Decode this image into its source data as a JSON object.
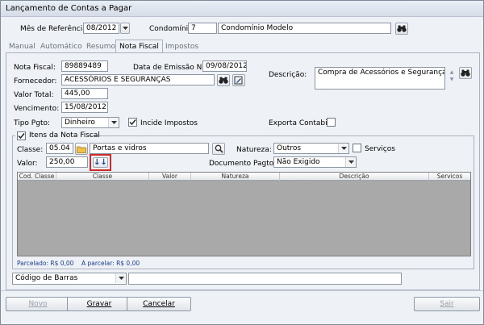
{
  "window": {
    "title": "Lançamento de Contas a Pagar"
  },
  "header": {
    "mes_label": "Mês de Referência:",
    "mes_value": "08/2012",
    "condominio_label": "Condomínio:",
    "condominio_code": "7",
    "condominio_name": "Condomínio Modelo"
  },
  "tabs": [
    {
      "label": "Manual"
    },
    {
      "label": "Automático"
    },
    {
      "label": "Resumo"
    },
    {
      "label": "Nota Fiscal"
    },
    {
      "label": "Impostos"
    }
  ],
  "nota": {
    "nf_label": "Nota Fiscal:",
    "nf_value": "89889489",
    "emissao_label": "Data de Emissão NF:",
    "emissao_value": "09/08/2012",
    "fornecedor_label": "Fornecedor:",
    "fornecedor_value": "ACESSÓRIOS E SEGURANÇAS",
    "descricao_label": "Descrição:",
    "descricao_value": "Compra de Acessórios e Seguranças",
    "valor_total_label": "Valor Total:",
    "valor_total_value": "445,00",
    "vencimento_label": "Vencimento:",
    "vencimento_value": "15/08/2012",
    "tipo_pgto_label": "Tipo Pgto:",
    "tipo_pgto_value": "Dinheiro",
    "incide_label": "Incide Impostos",
    "incide_checked": true,
    "exporta_label": "Exporta Contabil",
    "exporta_checked": false
  },
  "itens": {
    "group_label": "Itens da Nota Fiscal",
    "group_checked": true,
    "classe_label": "Classe:",
    "classe_code": "05.04",
    "classe_name": "Portas e vidros",
    "natureza_label": "Natureza:",
    "natureza_value": "Outros",
    "servicos_label": "Serviços",
    "valor_label": "Valor:",
    "valor_value": "250,00",
    "add_glyph": "↓↓",
    "documento_label": "Documento Pagto:",
    "documento_value": "Não Exigido",
    "grid_columns": [
      "Cod. Classe",
      "Classe",
      "Valor",
      "Natureza",
      "Descrição",
      "Servicos"
    ],
    "parcelado_label": "Parcelado: R$ 0,00",
    "a_parcelar_label": "A parcelar: R$ 0,00"
  },
  "barcode": {
    "type_value": "Código de Barras",
    "value": ""
  },
  "buttons": {
    "novo": "Novo",
    "gravar": "Gravar",
    "cancelar": "Cancelar",
    "sair": "Sair"
  },
  "colors": {
    "highlight": "#cf2a2a",
    "grid_bg": "#a9a9a9",
    "link_blue": "#1b3d8f"
  },
  "icons": [
    "binoculars-icon",
    "folder-icon",
    "search-icon",
    "pen-icon",
    "chevron-down-icon",
    "check-icon"
  ]
}
